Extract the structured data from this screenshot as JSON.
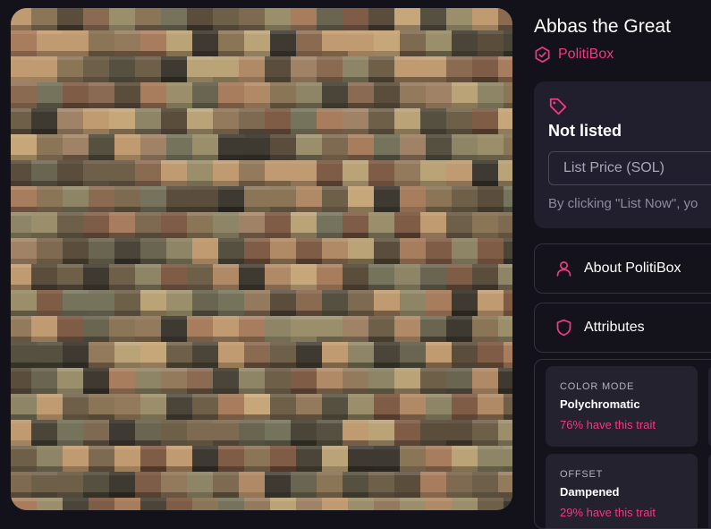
{
  "artwork": {
    "alt": "PolitiBox voxel artwork"
  },
  "title": "Abbas the Great",
  "collection": {
    "name": "PolitiBox",
    "icon": "verified-hexagon-icon",
    "color": "#ef3a84"
  },
  "listing": {
    "icon": "tag-icon",
    "status": "Not listed",
    "price_placeholder": "List Price (SOL)",
    "disclaimer": "By clicking \"List Now\", yo"
  },
  "sections": {
    "about": {
      "label": "About PolitiBox",
      "icon": "user-icon"
    },
    "attributes": {
      "label": "Attributes",
      "icon": "shield-icon"
    }
  },
  "attributes": [
    {
      "name": "COLOR MODE",
      "value": "Polychromatic",
      "rarity": "76% have this trait"
    },
    {
      "name": "OFFSET",
      "value": "Dampened",
      "rarity": "29% have this trait"
    }
  ],
  "colors": {
    "accent": "#ef3a84",
    "background": "#13121b",
    "card": "#211f2d"
  }
}
